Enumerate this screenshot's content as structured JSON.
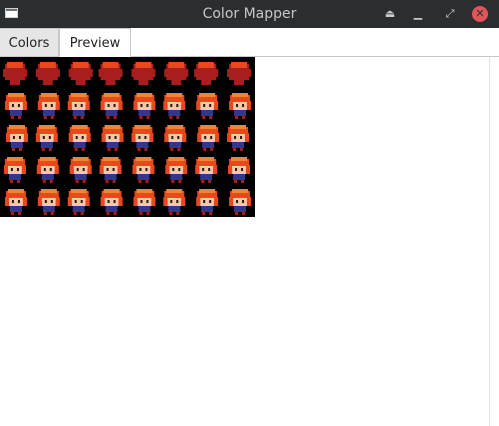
{
  "window": {
    "title": "Color Mapper",
    "icons": [
      "app-icon",
      "shade-icon",
      "minimize-icon",
      "maximize-icon",
      "close-icon"
    ]
  },
  "tabs": [
    {
      "label": "Colors",
      "active": false
    },
    {
      "label": "Preview",
      "active": true
    }
  ],
  "preview": {
    "sheet_rows": 5,
    "sheet_columns": 8,
    "palette": {
      "background": "#000000",
      "hair_dark": "#a81e1e",
      "hair": "#e8481c",
      "hair_light": "#f7842a",
      "skin": "#f8c8a0",
      "outfit": "#2b3a8c",
      "eyes": "#1a1a1a"
    }
  }
}
